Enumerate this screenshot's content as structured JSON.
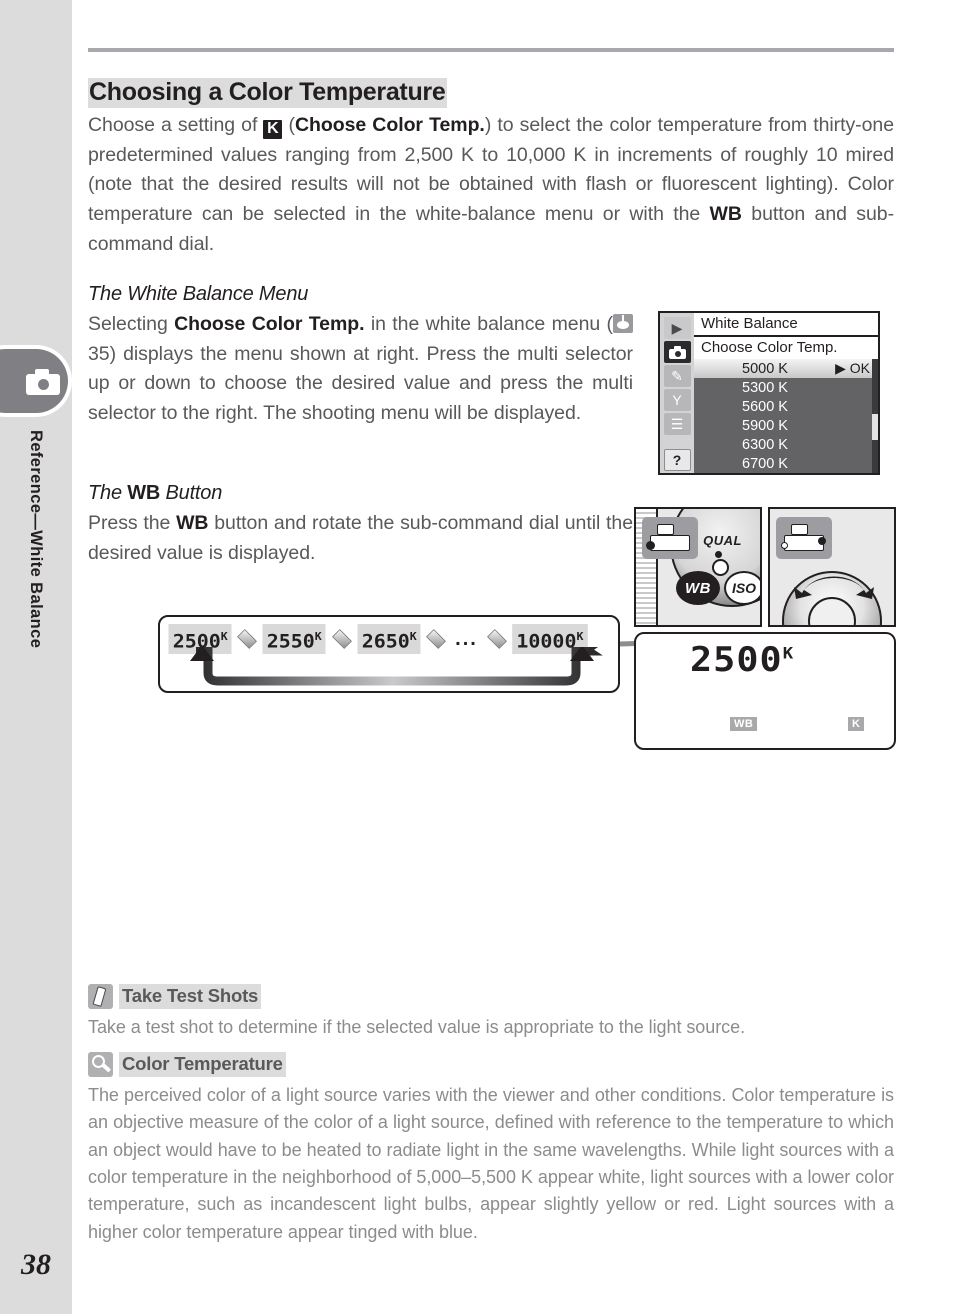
{
  "page": {
    "number": "38",
    "sidebar_label": "Reference—White Balance",
    "camera_tab_icon": "camera-icon"
  },
  "heading": {
    "title": "Choosing a Color Temperature"
  },
  "intro": {
    "part1": "Choose a setting of ",
    "k_glyph": "K",
    "part2": " (",
    "bold1": "Choose Color Temp.",
    "part3": ") to select the color temperature from thirty-one predetermined values ranging from 2,500 K to 10,000 K in increments of roughly 10 mired (note that the desired results will not be obtained with flash or fluorescent lighting).  Color temperature can be selected in the white-balance menu or with the ",
    "bold2": "WB",
    "part4": " button and sub-command dial."
  },
  "wb_menu_section": {
    "heading": "The White Balance Menu",
    "part1": "Selecting ",
    "bold1": "Choose Color Temp.",
    "part2": " in the white balance menu (",
    "ref_icon": "menu-reference-icon",
    "ref_page": "35",
    "part3": ") displays the menu shown at right.  Press the multi selector up or down to choose the desired value and press the multi selector to the right.  The shooting menu will be displayed."
  },
  "wb_button_section": {
    "heading_pre": "The ",
    "heading_bold": "WB",
    "heading_post": " Button",
    "part1": "Press the ",
    "bold1": "WB",
    "part2": " button and rotate the sub-command dial until the desired value is displayed."
  },
  "camera_menu": {
    "rail": [
      {
        "name": "playback-menu-icon",
        "glyph": "▶",
        "active": false
      },
      {
        "name": "shooting-menu-icon",
        "glyph": "camera",
        "active": true
      },
      {
        "name": "custom-settings-menu-icon",
        "glyph": "✎",
        "active": false
      },
      {
        "name": "setup-menu-icon",
        "glyph": "Y",
        "active": false
      },
      {
        "name": "recent-settings-menu-icon",
        "glyph": "☰",
        "active": false
      },
      {
        "name": "help-icon",
        "glyph": "?",
        "active": false
      }
    ],
    "title": "White Balance",
    "subtitle": "Choose Color Temp.",
    "ok_label": "▶ OK",
    "rows": [
      {
        "label": "5000 K",
        "selected": true
      },
      {
        "label": "5300 K",
        "selected": false
      },
      {
        "label": "5600 K",
        "selected": false
      },
      {
        "label": "5900 K",
        "selected": false
      },
      {
        "label": "6300 K",
        "selected": false
      },
      {
        "label": "6700 K",
        "selected": false
      }
    ]
  },
  "camera_photos": {
    "left": {
      "qual_label": "QUAL",
      "wb_label": "WB",
      "iso_label": "ISO",
      "badge": "camera-front-badge"
    },
    "right": {
      "badge": "camera-rear-badge",
      "dial": "sub-command-dial",
      "arrow": "rotate-arrow"
    }
  },
  "value_sequence": {
    "items": [
      {
        "value": "2500",
        "unit": "K"
      },
      {
        "value": "2550",
        "unit": "K"
      },
      {
        "value": "2650",
        "unit": "K"
      },
      {
        "value": "10000",
        "unit": "K"
      }
    ],
    "ellipsis": "...",
    "loop": "loop-arrow"
  },
  "lcd_panel": {
    "value": "2500",
    "unit": "K",
    "wb_indicator": "WB",
    "k_indicator": "K"
  },
  "notes": [
    {
      "icon": "pencil-icon",
      "title": "Take Test Shots",
      "body": "Take a test shot to determine if the selected value is appropriate to the light source."
    },
    {
      "icon": "magnifier-icon",
      "title": "Color Temperature",
      "body": "The perceived color of a light source varies with the viewer and other conditions.  Color temperature is an objective measure of the color of a light source, defined with reference to the temperature to which an object would have to be heated to radiate light in the same wavelengths.  While light sources with a color temperature in the neighborhood of 5,000–5,500 K appear white, light sources with a lower color temperature, such as incandescent light bulbs, appear slightly yellow or red.  Light sources with a higher color temperature appear tinged with blue."
    }
  ]
}
